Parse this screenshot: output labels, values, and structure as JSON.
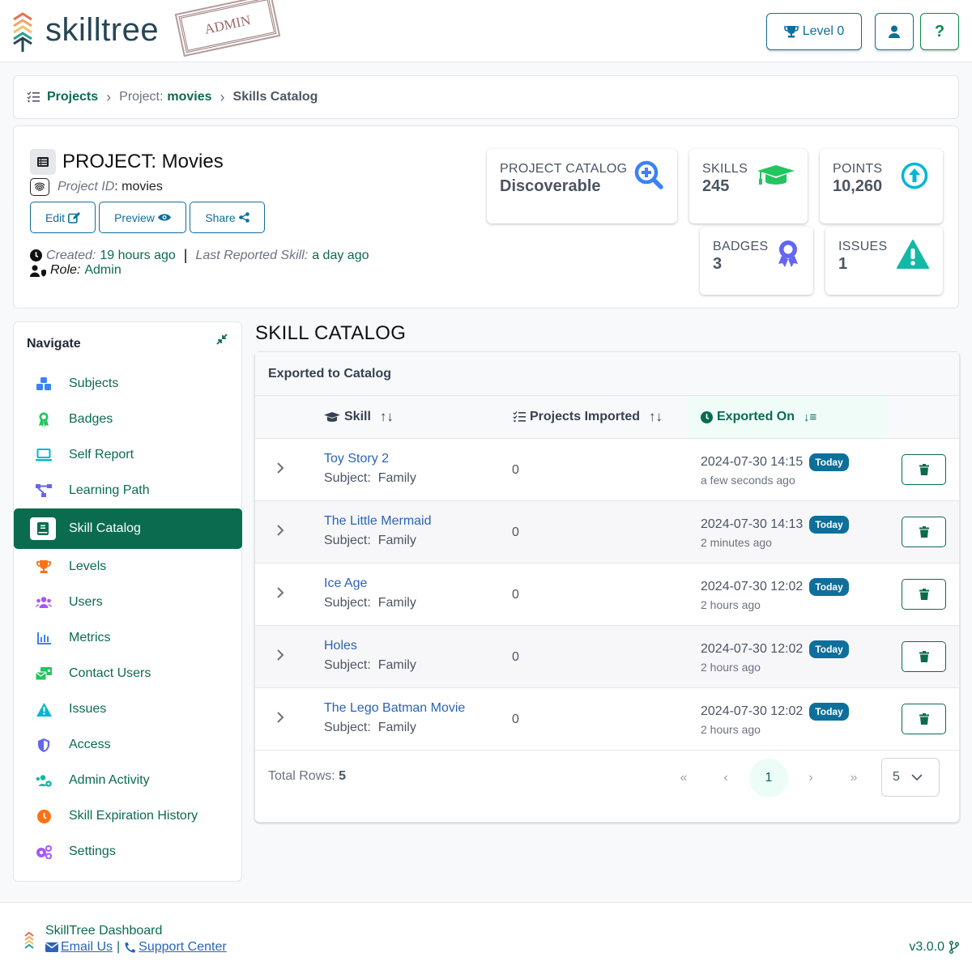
{
  "header": {
    "logo_text": "skilltree",
    "stamp_text": "ADMIN",
    "level_label": "Level 0"
  },
  "breadcrumb": {
    "projects": "Projects",
    "project_prefix": "Project:",
    "project_id": "movies",
    "current": "Skills Catalog"
  },
  "project": {
    "title": "PROJECT: Movies",
    "id_label": "Project ID",
    "id_value": ": movies",
    "buttons": {
      "edit": "Edit",
      "preview": "Preview",
      "share": "Share"
    },
    "created_label": "Created:",
    "created_value": "19 hours ago",
    "separator": "|",
    "last_reported_label": "Last Reported Skill:",
    "last_reported_value": "a day ago",
    "role_label": "Role:",
    "role_value": "Admin"
  },
  "stats": [
    {
      "label": "PROJECT CATALOG",
      "value": "Discoverable",
      "icon": "search-plus-icon",
      "color": "#3b82f6"
    },
    {
      "label": "SKILLS",
      "value": "245",
      "icon": "graduation-cap-icon",
      "color": "#22c55e"
    },
    {
      "label": "POINTS",
      "value": "10,260",
      "icon": "arrow-circle-up-icon",
      "color": "#06b6d4"
    },
    {
      "label": "BADGES",
      "value": "3",
      "icon": "award-icon",
      "color": "#6366f1"
    },
    {
      "label": "ISSUES",
      "value": "1",
      "icon": "warning-icon",
      "color": "#14b8a6"
    }
  ],
  "nav": {
    "title": "Navigate",
    "items": [
      {
        "label": "Subjects",
        "icon": "cubes-icon",
        "color": "#3b82f6"
      },
      {
        "label": "Badges",
        "icon": "award-icon",
        "color": "#22c55e"
      },
      {
        "label": "Self Report",
        "icon": "laptop-icon",
        "color": "#06b6d4"
      },
      {
        "label": "Learning Path",
        "icon": "network-icon",
        "color": "#6366f1"
      },
      {
        "label": "Skill Catalog",
        "icon": "book-icon",
        "color": "#0b6b4f",
        "active": true
      },
      {
        "label": "Levels",
        "icon": "trophy-icon",
        "color": "#f97316"
      },
      {
        "label": "Users",
        "icon": "users-icon",
        "color": "#a855f7"
      },
      {
        "label": "Metrics",
        "icon": "chart-bar-icon",
        "color": "#3b82f6"
      },
      {
        "label": "Contact Users",
        "icon": "mail-bulk-icon",
        "color": "#22c55e"
      },
      {
        "label": "Issues",
        "icon": "warning-icon",
        "color": "#06b6d4"
      },
      {
        "label": "Access",
        "icon": "shield-icon",
        "color": "#6366f1"
      },
      {
        "label": "Admin Activity",
        "icon": "users-cog-icon",
        "color": "#14b8a6"
      },
      {
        "label": "Skill Expiration History",
        "icon": "clock-icon",
        "color": "#f97316"
      },
      {
        "label": "Settings",
        "icon": "cogs-icon",
        "color": "#a855f7"
      }
    ]
  },
  "main": {
    "title": "SKILL CATALOG",
    "table_title": "Exported to Catalog",
    "columns": {
      "skill": "Skill",
      "projects_imported": "Projects Imported",
      "exported_on": "Exported On"
    },
    "subject_label": "Subject:",
    "rows": [
      {
        "skill": "Toy Story 2",
        "subject": "Family",
        "imported": "0",
        "date": "2024-07-30 14:15",
        "badge": "Today",
        "ago": "a few seconds ago"
      },
      {
        "skill": "The Little Mermaid",
        "subject": "Family",
        "imported": "0",
        "date": "2024-07-30 14:13",
        "badge": "Today",
        "ago": "2 minutes ago"
      },
      {
        "skill": "Ice Age",
        "subject": "Family",
        "imported": "0",
        "date": "2024-07-30 12:02",
        "badge": "Today",
        "ago": "2 hours ago"
      },
      {
        "skill": "Holes",
        "subject": "Family",
        "imported": "0",
        "date": "2024-07-30 12:02",
        "badge": "Today",
        "ago": "2 hours ago"
      },
      {
        "skill": "The Lego Batman Movie",
        "subject": "Family",
        "imported": "0",
        "date": "2024-07-30 12:02",
        "badge": "Today",
        "ago": "2 hours ago"
      }
    ],
    "total_rows_label": "Total Rows:",
    "total_rows": "5",
    "pager": {
      "first": "«",
      "prev": "‹",
      "current": "1",
      "next": "›",
      "last": "»"
    },
    "page_size": "5"
  },
  "footer": {
    "title": "SkillTree Dashboard",
    "email": "Email Us",
    "divider": "|",
    "support": "Support Center",
    "version": "v3.0.0"
  }
}
